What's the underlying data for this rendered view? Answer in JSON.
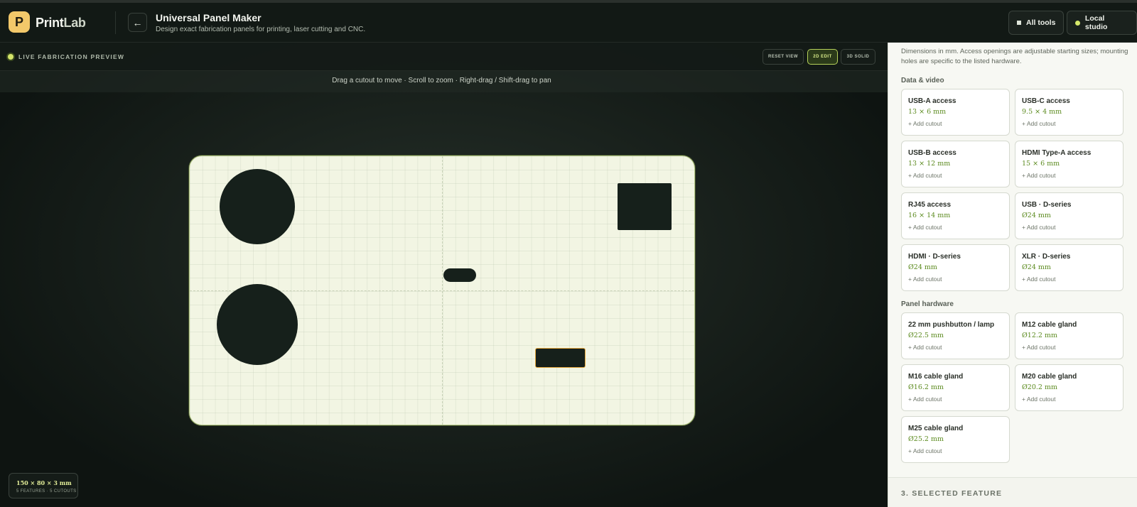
{
  "header": {
    "logo_letter": "P",
    "brand_print": "Print",
    "brand_lab": "Lab",
    "back_glyph": "←",
    "title": "Universal Panel Maker",
    "subtitle": "Design exact fabrication panels for printing, laser cutting and CNC.",
    "all_tools": "All tools",
    "local_studio": "Local studio"
  },
  "preview": {
    "live_label": "LIVE FABRICATION PREVIEW",
    "reset_view": "RESET VIEW",
    "edit_2d": "2D EDIT",
    "solid_3d": "3D SOLID",
    "hint": "Drag a cutout to move · Scroll to zoom · Right-drag / Shift-drag to pan",
    "dims": "150 × 80 × 3 mm",
    "summary": "5 FEATURES · 5 CUTOUTS"
  },
  "sidebar": {
    "note": "Dimensions in mm. Access openings are adjustable starting sizes; mounting holes are specific to the listed hardware.",
    "data_video_label": "Data & video",
    "data_video": [
      {
        "name": "USB-A access",
        "size": "13 × 6 mm",
        "add": "+ Add cutout"
      },
      {
        "name": "USB-C access",
        "size": "9.5 × 4 mm",
        "add": "+ Add cutout"
      },
      {
        "name": "USB-B access",
        "size": "13 × 12 mm",
        "add": "+ Add cutout"
      },
      {
        "name": "HDMI Type-A access",
        "size": "15 × 6 mm",
        "add": "+ Add cutout"
      },
      {
        "name": "RJ45 access",
        "size": "16 × 14 mm",
        "add": "+ Add cutout"
      },
      {
        "name": "USB · D-series",
        "size": "Ø24 mm",
        "add": "+ Add cutout"
      },
      {
        "name": "HDMI · D-series",
        "size": "Ø24 mm",
        "add": "+ Add cutout"
      },
      {
        "name": "XLR · D-series",
        "size": "Ø24 mm",
        "add": "+ Add cutout"
      }
    ],
    "hardware_label": "Panel hardware",
    "hardware": [
      {
        "name": "22 mm pushbutton / lamp",
        "size": "Ø22.5 mm",
        "add": "+ Add cutout"
      },
      {
        "name": "M12 cable gland",
        "size": "Ø12.2 mm",
        "add": "+ Add cutout"
      },
      {
        "name": "M16 cable gland",
        "size": "Ø16.2 mm",
        "add": "+ Add cutout"
      },
      {
        "name": "M20 cable gland",
        "size": "Ø20.2 mm",
        "add": "+ Add cutout"
      },
      {
        "name": "M25 cable gland",
        "size": "Ø25.2 mm",
        "add": "+ Add cutout"
      }
    ],
    "selected_feature": "3. SELECTED FEATURE"
  },
  "colors": {
    "accent": "#d5e86a",
    "panel": "#f2f5e3",
    "cutout": "#16201b",
    "selection": "#e5a73b",
    "logo": "#f2c86a"
  }
}
